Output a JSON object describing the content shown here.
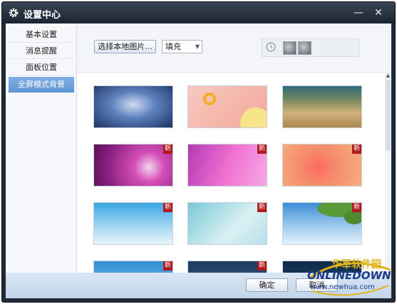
{
  "window": {
    "title": "设置中心",
    "minimize_glyph": "—",
    "close_glyph": "✕"
  },
  "sidebar": {
    "items": [
      {
        "label": "基本设置",
        "active": false
      },
      {
        "label": "消息提醒",
        "active": false
      },
      {
        "label": "面板位置",
        "active": false
      },
      {
        "label": "全屏模式背景",
        "active": true
      }
    ]
  },
  "toolbar": {
    "choose_local_image": "选择本地图片...",
    "fill_mode": {
      "selected": "填充"
    },
    "recent_icon": "clock-icon"
  },
  "wallpapers": [
    {
      "id": "wp-1",
      "is_new": false
    },
    {
      "id": "wp-2",
      "is_new": false
    },
    {
      "id": "wp-3",
      "is_new": false
    },
    {
      "id": "wp-4",
      "is_new": true
    },
    {
      "id": "wp-5",
      "is_new": true
    },
    {
      "id": "wp-6",
      "is_new": true
    },
    {
      "id": "wp-7",
      "is_new": true
    },
    {
      "id": "wp-8",
      "is_new": true
    },
    {
      "id": "wp-9",
      "is_new": true
    },
    {
      "id": "wp-10",
      "is_new": true
    },
    {
      "id": "wp-11",
      "is_new": true
    },
    {
      "id": "wp-12",
      "is_new": false
    }
  ],
  "new_badge_label": "新",
  "footer": {
    "ok_label": "确定",
    "cancel_label": "取消"
  },
  "watermark": {
    "cn": "华军软件园",
    "en": "ONLINEDOWN",
    "url": "www.newhua.com"
  },
  "colors": {
    "titlebar": "#1f2a36",
    "active_item": "#6fa2dd",
    "badge": "#b0181e"
  }
}
